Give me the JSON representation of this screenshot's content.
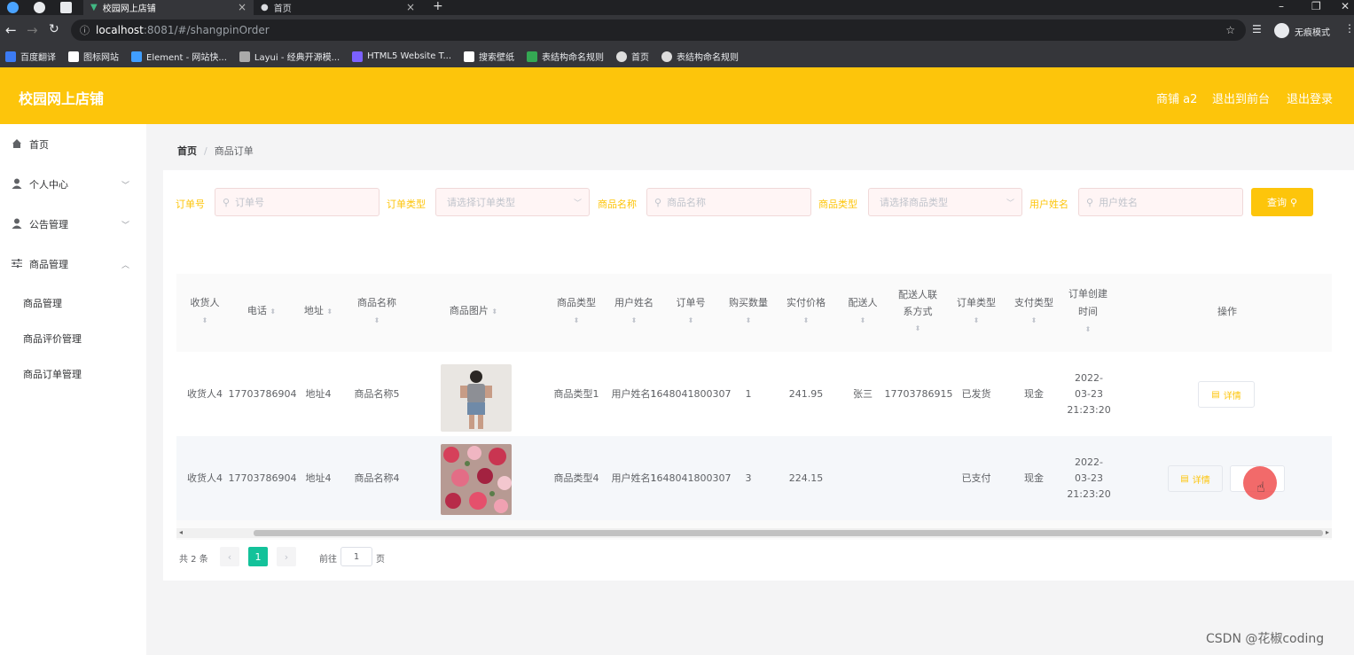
{
  "browser": {
    "tabs": [
      {
        "title": "校园网上店铺",
        "active": true
      },
      {
        "title": "首页",
        "active": false
      }
    ],
    "url_host": "localhost",
    "url_path": ":8081/#/shangpinOrder",
    "incognito_label": "无痕模式",
    "bookmarks": [
      "百度翻译",
      "图标网站",
      "Element - 网站快...",
      "Layui - 经典开源模...",
      "HTML5 Website T...",
      "搜索壁纸",
      "表结构命名规则",
      "首页",
      "表结构命名规则"
    ]
  },
  "header": {
    "brand": "校园网上店铺",
    "user": "商铺 a2",
    "back_front": "退出到前台",
    "logout": "退出登录",
    "accent": "#fdc50b"
  },
  "sidebar": {
    "items": [
      {
        "label": "首页",
        "icon": "home-icon"
      },
      {
        "label": "个人中心",
        "icon": "user-icon"
      },
      {
        "label": "公告管理",
        "icon": "user-icon"
      },
      {
        "label": "商品管理",
        "icon": "sliders-icon"
      }
    ],
    "sub_items": [
      "商品管理",
      "商品评价管理",
      "商品订单管理"
    ]
  },
  "breadcrumb": {
    "home": "首页",
    "sep": "/",
    "current": "商品订单"
  },
  "filters": {
    "order_no_label": "订单号",
    "order_no_placeholder": "订单号",
    "order_type_label": "订单类型",
    "order_type_placeholder": "请选择订单类型",
    "product_name_label": "商品名称",
    "product_name_placeholder": "商品名称",
    "product_type_label": "商品类型",
    "product_type_placeholder": "请选择商品类型",
    "user_name_label": "用户姓名",
    "user_name_placeholder": "用户姓名",
    "search_btn": "查询"
  },
  "table": {
    "headers": {
      "receiver": "收货人",
      "phone": "电话",
      "address": "地址",
      "product_name": "商品名称",
      "product_image": "商品图片",
      "product_type": "商品类型",
      "user_name": "用户姓名",
      "order_no": "订单号",
      "quantity": "购买数量",
      "paid_price": "实付价格",
      "courier": "配送人",
      "courier_contact": "配送人联系方式",
      "order_type": "订单类型",
      "payment_type": "支付类型",
      "created_time": "订单创建时间",
      "actions": "操作"
    },
    "rows": [
      {
        "receiver": "收货人4",
        "phone": "17703786904",
        "address": "地址4",
        "product_name": "商品名称5",
        "product_type": "商品类型1",
        "user_name": "用户姓名1",
        "order_no": "1648041800307",
        "quantity": "1",
        "paid_price": "241.95",
        "courier": "张三",
        "courier_contact": "17703786915",
        "order_type": "已发货",
        "payment_type": "现金",
        "created_time": "2022-03-23 21:23:20",
        "detail_btn": "详情"
      },
      {
        "receiver": "收货人4",
        "phone": "17703786904",
        "address": "地址4",
        "product_name": "商品名称4",
        "product_type": "商品类型4",
        "user_name": "用户姓名1",
        "order_no": "1648041800307",
        "quantity": "3",
        "paid_price": "224.15",
        "courier": "",
        "courier_contact": "",
        "order_type": "已支付",
        "payment_type": "现金",
        "created_time": "2022-03-23 21:23:20",
        "detail_btn": "详情",
        "ship_btn": ""
      }
    ]
  },
  "pagination": {
    "total": "共 2 条",
    "current": "1",
    "goto_label": "前往",
    "goto_value": "1",
    "page_suffix": "页"
  },
  "watermark": "CSDN @花椒coding"
}
